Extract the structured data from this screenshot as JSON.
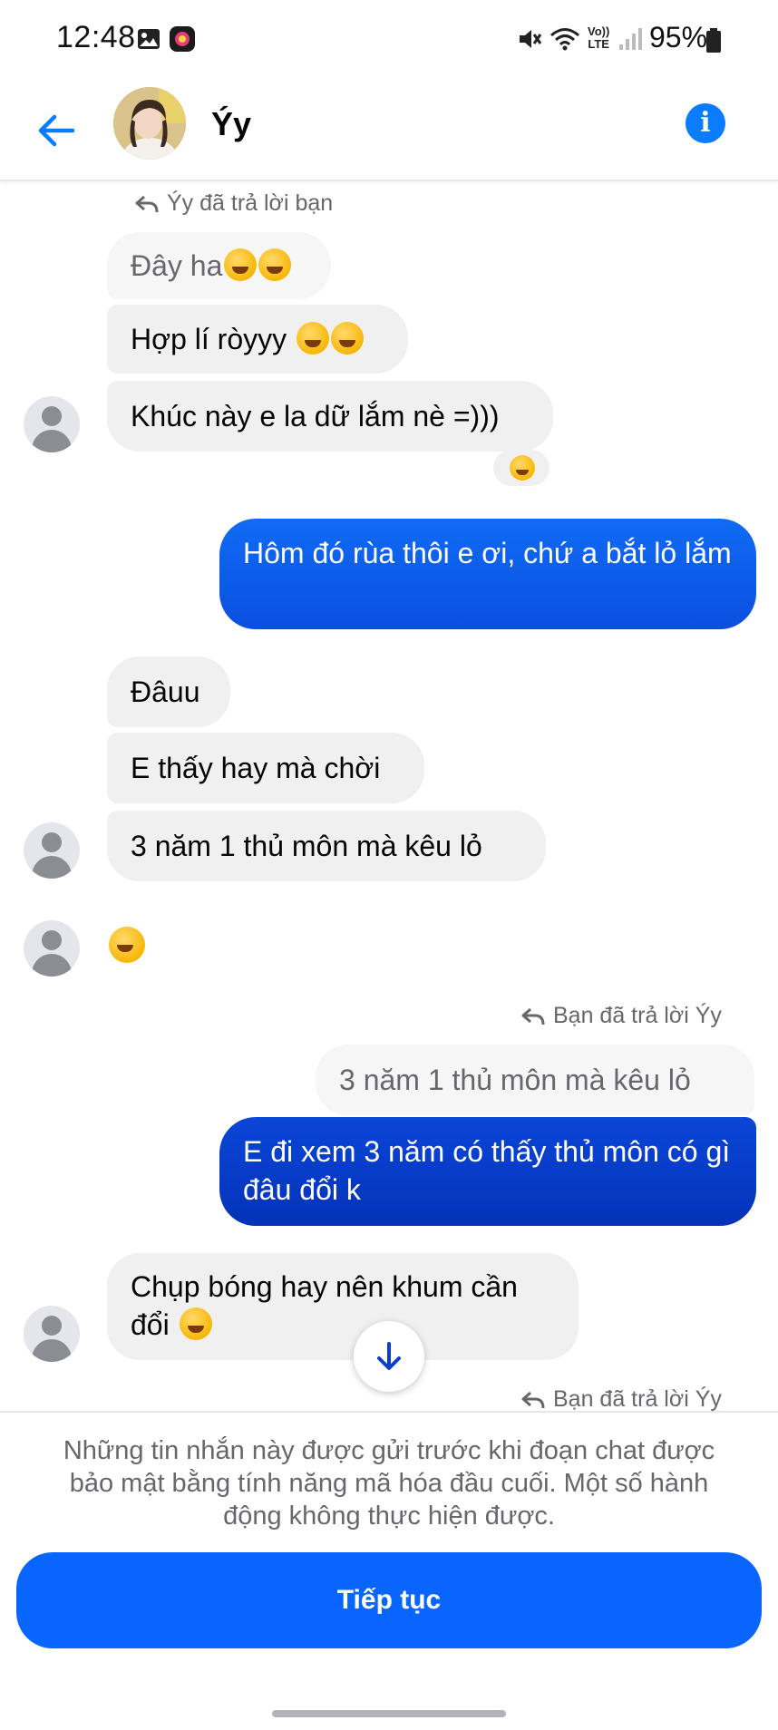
{
  "status_bar": {
    "time": "12:48",
    "battery": "95%",
    "network": "LTE"
  },
  "header": {
    "contact_name": "Ýy",
    "back_icon": "arrow-left-icon",
    "info_icon": "info-icon"
  },
  "messages": [
    {
      "type": "reply_note",
      "text": "Ýy đã trả lời bạn"
    },
    {
      "type": "incoming_quote",
      "text": "Đây ha"
    },
    {
      "type": "incoming",
      "text": "Hợp lí ròyyy "
    },
    {
      "type": "incoming",
      "text": "Khúc này e la dữ lắm nè =)))",
      "reaction": "laughing-emoji"
    },
    {
      "type": "outgoing",
      "text": "Hôm đó rùa thôi e ơi, chứ a bắt lỏ lắm"
    },
    {
      "type": "incoming",
      "text": "Đâuu"
    },
    {
      "type": "incoming",
      "text": "E thấy hay mà chời"
    },
    {
      "type": "incoming",
      "text": "3 năm 1 thủ môn mà kêu lỏ"
    },
    {
      "type": "incoming_emoji",
      "emoji": "pleading-face-emoji"
    },
    {
      "type": "reply_note",
      "text": "Bạn đã trả lời Ýy"
    },
    {
      "type": "outgoing_quote",
      "text": "3 năm 1 thủ môn mà kêu lỏ"
    },
    {
      "type": "outgoing",
      "text": "E đi xem 3 năm có thấy thủ môn có gì đâu đổi k"
    },
    {
      "type": "incoming",
      "text": "Chụp bóng hay nên khum cần đổi "
    },
    {
      "type": "reply_note",
      "text": "Bạn đã trả lời Ýy"
    }
  ],
  "footer": {
    "notice": "Những tin nhắn này được gửi trước khi đoạn chat được bảo mật bằng tính năng mã hóa đầu cuối. Một số hành động không thực hiện được.",
    "continue_label": "Tiếp tục"
  },
  "colors": {
    "accent": "#0866ff",
    "outgoing_bubble": "#0b4fe0",
    "incoming_bubble": "#f0f0f0",
    "secondary_text": "#65676b"
  }
}
